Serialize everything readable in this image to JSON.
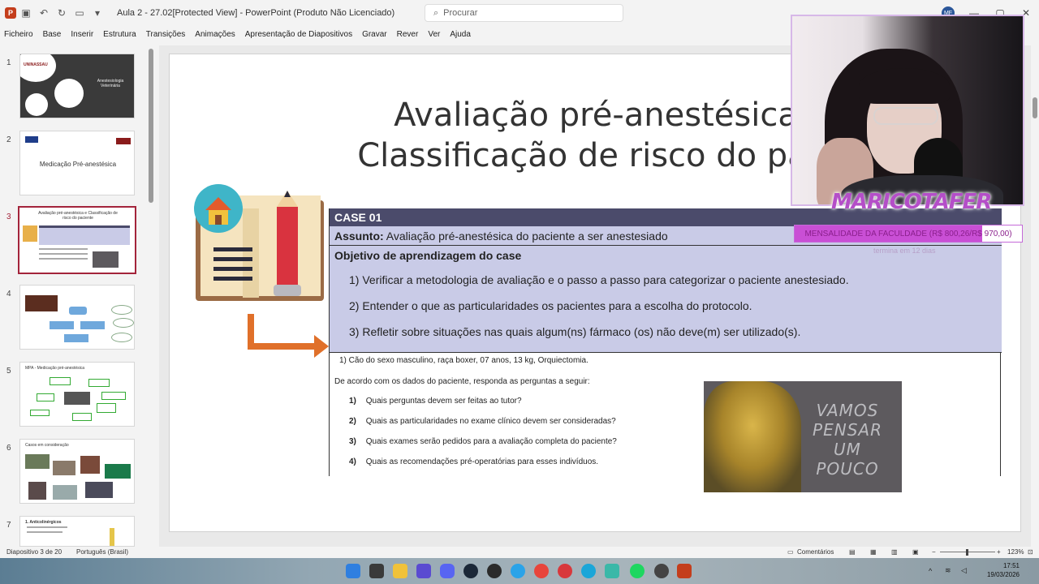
{
  "window": {
    "title": "Aula 2 - 27.02[Protected View] - PowerPoint (Produto Não Licenciado)",
    "search_placeholder": "Procurar",
    "user_initials": "MF"
  },
  "menu": [
    "Ficheiro",
    "Base",
    "Inserir",
    "Estrutura",
    "Transições",
    "Animações",
    "Apresentação de Diapositivos",
    "Gravar",
    "Rever",
    "Ver",
    "Ajuda"
  ],
  "thumbnails": [
    {
      "num": "1",
      "label": "Anestesiologia Veterinária"
    },
    {
      "num": "2",
      "label": "Medicação Pré-anestésica"
    },
    {
      "num": "3",
      "label": "Avaliação pré-anestésica e Classificação de risco do paciente"
    },
    {
      "num": "4",
      "label": ""
    },
    {
      "num": "5",
      "label": "MPA - Medicação pré-anestésica"
    },
    {
      "num": "6",
      "label": "Casos em consideração"
    },
    {
      "num": "7",
      "label": "1. Anticolinérgicos"
    }
  ],
  "slide": {
    "title_line1": "Avaliação pré-anestésica",
    "title_line2": "Classificação de risco do paci",
    "case_header": "CASE 01",
    "subject_label": "Assunto:",
    "subject_text": "Avaliação pré-anestésica do paciente a ser anestesiado",
    "objective_heading": "Objetivo de aprendizagem do case",
    "objectives": [
      "1) Verificar a metodologia de avaliação e o passo a passo para categorizar o paciente anestesiado.",
      "2) Entender o que as particularidades os pacientes para a escolha do protocolo.",
      "3) Refletir sobre situações nas quais algum(ns) fármaco (os) não deve(m) ser utilizado(s)."
    ],
    "patient": "1) Cão do sexo masculino, raça boxer, 07 anos, 13 kg, Orquiectomia.",
    "instruction": "De acordo com os dados do paciente, responda as perguntas a seguir:",
    "questions": [
      {
        "n": "1)",
        "text": "Quais perguntas devem ser feitas ao tutor?"
      },
      {
        "n": "2)",
        "text": "Quais as particularidades no exame clínico devem ser consideradas?"
      },
      {
        "n": "3)",
        "text": "Quais exames serão pedidos para a avaliação completa do paciente?"
      },
      {
        "n": "4)",
        "text": "Quais as recomendações pré-operatórias para esses indivíduos."
      }
    ],
    "image_caption": "VAMOS\nPENSAR\nUM\nPOUCO"
  },
  "overlay": {
    "brand_text": "MARICOTAFER",
    "tuition_text": "MENSALIDADE DA FACULDADE (R$ 800,26/R$ 970,00)",
    "tuition_progress": 0.825,
    "tuition_sub": "termina em 12 dias"
  },
  "status": {
    "slide_info": "Diapositivo 3 de 20",
    "language": "Português (Brasil)",
    "comments": "Comentários",
    "zoom": "123%"
  },
  "clock": {
    "time": "17:51",
    "date": "19/03/2026"
  },
  "colors": {
    "accent": "#a3243b",
    "case_header_bg": "#4b4b6b",
    "case_body_bg": "#c9cbe7",
    "brand": "#b44ec8"
  }
}
